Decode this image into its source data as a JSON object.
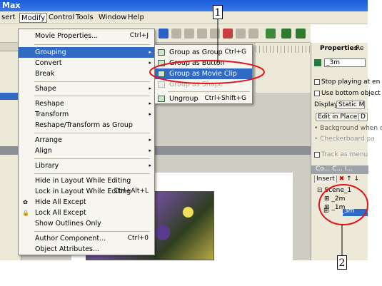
{
  "window": {
    "title": "Max"
  },
  "menubar": {
    "items": [
      "sert",
      "Modify",
      "Control",
      "Tools",
      "Window",
      "Help"
    ],
    "active": "Modify"
  },
  "modify_menu": {
    "items": [
      {
        "label": "Movie Properties...",
        "shortcut": "Ctrl+J"
      },
      {
        "label": "Grouping",
        "submenu": true,
        "highlighted": true
      },
      {
        "label": "Convert",
        "submenu": true
      },
      {
        "label": "Break"
      },
      {
        "label": "Shape",
        "submenu": true
      },
      {
        "label": "Reshape",
        "submenu": true
      },
      {
        "label": "Transform",
        "submenu": true
      },
      {
        "label": "Reshape/Transform as Group"
      },
      {
        "label": "Arrange",
        "submenu": true
      },
      {
        "label": "Align",
        "submenu": true
      },
      {
        "label": "Library",
        "submenu": true
      },
      {
        "label": "Hide in Layout While Editing"
      },
      {
        "label": "Lock in Layout While Editing",
        "shortcut": "Ctrl+Alt+L"
      },
      {
        "label": "Hide All Except"
      },
      {
        "label": "Lock All Except"
      },
      {
        "label": "Show Outlines Only"
      },
      {
        "label": "Author Component...",
        "shortcut": "Ctrl+0"
      },
      {
        "label": "Object Attributes..."
      }
    ]
  },
  "grouping_submenu": {
    "items": [
      {
        "label": "Group as Group",
        "shortcut": "Ctrl+G"
      },
      {
        "label": "Group as Button"
      },
      {
        "label": "Group as Movie Clip",
        "highlighted": true
      },
      {
        "label": "Group as Shape",
        "disabled": true
      },
      {
        "label": "Ungroup",
        "shortcut": "Ctrl+Shift+G"
      }
    ]
  },
  "properties_panel": {
    "tabs": [
      "Properties",
      "Re"
    ],
    "name_value": "_3m",
    "stop_playing": "Stop playing at en",
    "use_bottom": "Use bottom object",
    "display_label": "Display",
    "display_value": "Static Movie",
    "edit_in_place": "Edit in Place",
    "edit_btn2": "D",
    "background_when": "Background when c",
    "checkerboard": "Checkerboard pa",
    "track_as_menu": "Track as menu"
  },
  "contents_panel": {
    "tabs": [
      "Co...",
      "C...",
      "I..."
    ],
    "insert_label": "Insert",
    "tree": [
      {
        "label": "Scene_1",
        "level": 0
      },
      {
        "label": "_2m",
        "level": 1
      },
      {
        "label": "_1m",
        "level": 1
      },
      {
        "label": "_3m",
        "level": 1,
        "selected": true
      }
    ]
  },
  "annotations": {
    "callout1": "1",
    "callout2": "2"
  },
  "colors": {
    "highlight": "#316ac5",
    "annotation": "#e8121b",
    "title_bar": "#1a5bd8"
  },
  "icons": {
    "submenu_arrow": "▸",
    "expand": "⊞"
  }
}
